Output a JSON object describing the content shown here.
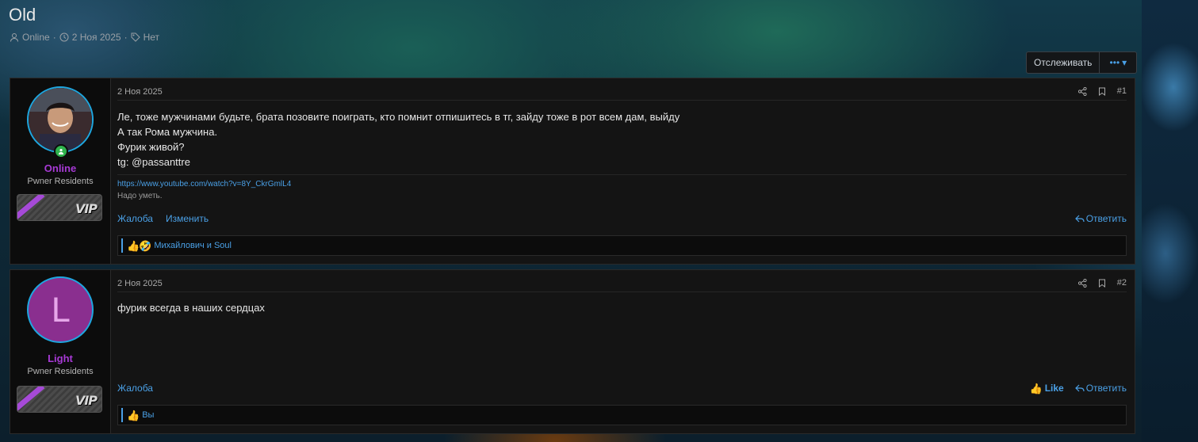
{
  "thread": {
    "title": "Old",
    "author": "Online",
    "date": "2 Ноя 2025",
    "tag": "Нет",
    "follow_label": "Отслеживать",
    "more_label": "•••"
  },
  "posts": [
    {
      "user": {
        "name": "Online",
        "role": "Pwner Residents",
        "badge": "VIP"
      },
      "date": "2 Ноя 2025",
      "number": "#1",
      "lines": [
        "Ле, тоже мужчинами будьте, брата позовите поиграть, кто помнит отпишитесь в тг, зайду тоже в рот всем дам, выйду",
        "А так Рома мужчина.",
        "Фурик живой?",
        "tg: @passanttre"
      ],
      "signature_link": "https://www.youtube.com/watch?v=8Y_CkrGmlL4",
      "signature_note": "Надо уметь.",
      "report": "Жалоба",
      "edit": "Изменить",
      "reply": "Ответить",
      "reactions": "Михайлович и Soul"
    },
    {
      "user": {
        "name": "Light",
        "role": "Pwner Residents",
        "badge": "VIP",
        "initial": "L"
      },
      "date": "2 Ноя 2025",
      "number": "#2",
      "lines": [
        "фурик всегда в наших сердцах"
      ],
      "report": "Жалоба",
      "like": "Like",
      "reply": "Ответить",
      "reactions": "Вы"
    }
  ],
  "colors": {
    "accent": "#4aa0e6",
    "username": "#a83ad6",
    "online": "#2fb34d",
    "avatar_L_bg": "#8a2f8f"
  }
}
